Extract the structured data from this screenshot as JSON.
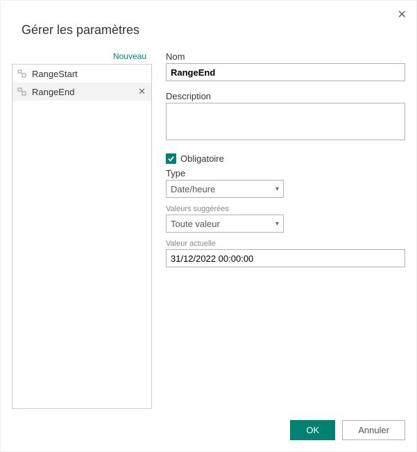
{
  "dialog": {
    "title": "Gérer les paramètres"
  },
  "sidebar": {
    "new_label": "Nouveau",
    "items": [
      {
        "label": "RangeStart"
      },
      {
        "label": "RangeEnd"
      }
    ],
    "selected_index": 1
  },
  "form": {
    "name_label": "Nom",
    "name_value": "RangeEnd",
    "description_label": "Description",
    "description_value": "",
    "required_label": "Obligatoire",
    "required_checked": true,
    "type_label": "Type",
    "type_value": "Date/heure",
    "suggested_label": "Valeurs suggérées",
    "suggested_value": "Toute valeur",
    "current_label": "Valeur actuelle",
    "current_value": "31/12/2022 00:00:00"
  },
  "footer": {
    "ok_label": "OK",
    "cancel_label": "Annuler"
  },
  "colors": {
    "accent": "#008272"
  }
}
